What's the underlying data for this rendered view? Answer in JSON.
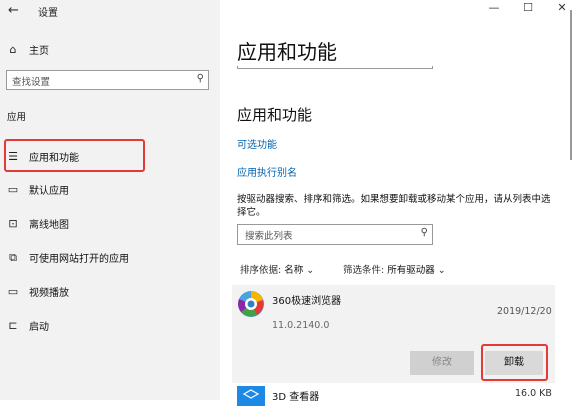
{
  "window": {
    "title": "设置",
    "back_icon": "←",
    "minimize": "—",
    "maximize": "☐",
    "close": "✕"
  },
  "sidebar": {
    "home_label": "主页",
    "search_placeholder": "查找设置",
    "section_label": "应用",
    "items": [
      {
        "label": "应用和功能",
        "icon": "list-icon"
      },
      {
        "label": "默认应用",
        "icon": "default-apps-icon"
      },
      {
        "label": "离线地图",
        "icon": "map-icon"
      },
      {
        "label": "可使用网站打开的应用",
        "icon": "website-apps-icon"
      },
      {
        "label": "视频播放",
        "icon": "video-icon"
      },
      {
        "label": "启动",
        "icon": "startup-icon"
      }
    ]
  },
  "main": {
    "page_title": "应用和功能",
    "section_title": "应用和功能",
    "link_optional": "可选功能",
    "link_aliases": "应用执行别名",
    "description": "按驱动器搜索、排序和筛选。如果想要卸载或移动某个应用，请从列表中选择它。",
    "list_search_placeholder": "搜索此列表",
    "sort_label": "排序依据:",
    "sort_value": "名称",
    "filter_label": "筛选条件:",
    "filter_value": "所有驱动器",
    "apps": [
      {
        "name": "360极速浏览器",
        "version": "11.0.2140.0",
        "date": "2019/12/20",
        "modify_label": "修改",
        "uninstall_label": "卸载"
      },
      {
        "name": "3D 查看器",
        "size": "16.0 KB"
      }
    ]
  }
}
